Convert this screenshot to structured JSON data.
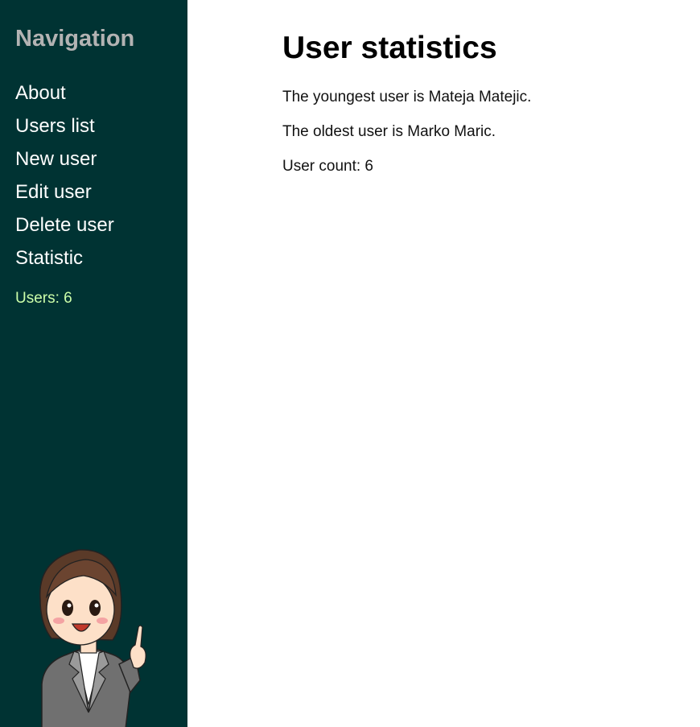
{
  "sidebar": {
    "title": "Navigation",
    "items": [
      {
        "label": "About"
      },
      {
        "label": "Users list"
      },
      {
        "label": "New user"
      },
      {
        "label": "Edit user"
      },
      {
        "label": "Delete user"
      },
      {
        "label": "Statistic"
      }
    ],
    "user_count": "Users: 6"
  },
  "main": {
    "title": "User statistics",
    "youngest": "The youngest user is Mateja Matejic.",
    "oldest": "The oldest user is Marko Maric.",
    "count": "User count: 6"
  },
  "colors": {
    "sidebar_bg": "#003333",
    "sidebar_title": "#b3b3b3",
    "nav_link": "#ffffff",
    "user_count": "#ccffaa"
  },
  "icons": {
    "mascot": "woman-pointing-illustration"
  }
}
